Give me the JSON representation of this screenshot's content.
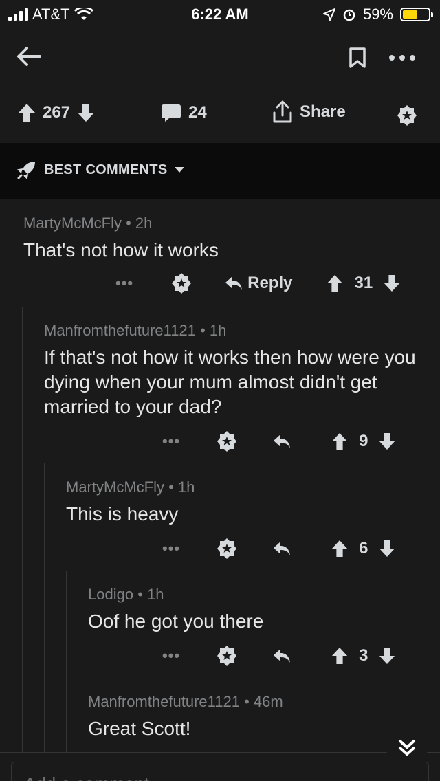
{
  "status": {
    "carrier": "AT&T",
    "time": "6:22 AM",
    "battery": "59%",
    "battery_level": 0.59,
    "battery_color": "#ffd60a"
  },
  "post": {
    "upvotes": "267",
    "comments": "24",
    "share_label": "Share"
  },
  "sort": {
    "label": "BEST COMMENTS"
  },
  "comments": [
    {
      "author": "MartyMcMcFly",
      "age": "2h",
      "body": "That's not how it works",
      "reply_label": "Reply",
      "score": "31"
    },
    {
      "author": "Manfromthefuture1121",
      "age": "1h",
      "body": "If that's not how it works then how were you dying when your mum almost didn't get married to your dad?",
      "score": "9"
    },
    {
      "author": "MartyMcMcFly",
      "age": "1h",
      "body": "This is heavy",
      "score": "6"
    },
    {
      "author": "Lodigo",
      "age": "1h",
      "body": "Oof he got you there",
      "score": "3"
    },
    {
      "author": "Manfromthefuture1121",
      "age": "46m",
      "body": "Great Scott!"
    }
  ],
  "compose": {
    "placeholder": "Add a comment"
  },
  "icons": {
    "back": "arrow-left-icon",
    "bookmark": "bookmark-icon",
    "more": "more-dots-icon",
    "upvote": "upvote-arrow-icon",
    "downvote": "downvote-arrow-icon",
    "comment": "comment-bubble-icon",
    "share": "share-icon",
    "award": "award-icon",
    "rocket": "rocket-icon",
    "reply": "reply-arrow-icon",
    "scroll_down": "double-chevron-down-icon"
  }
}
